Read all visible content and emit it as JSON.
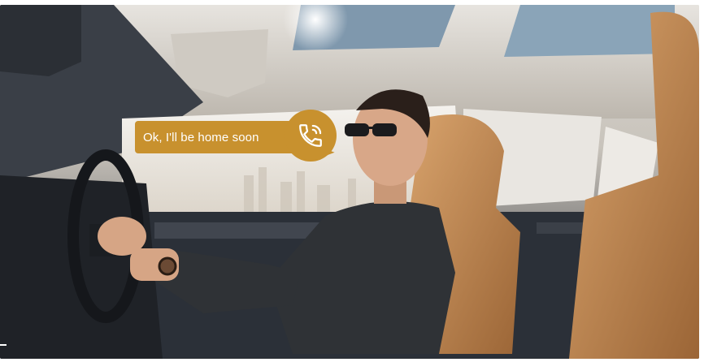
{
  "scene": {
    "description_icon": "car-interior-photo",
    "accent_color": "#c8912e"
  },
  "chat_bubble": {
    "text": "Ok, I'll be home soon",
    "icon": "phone-call-icon"
  }
}
